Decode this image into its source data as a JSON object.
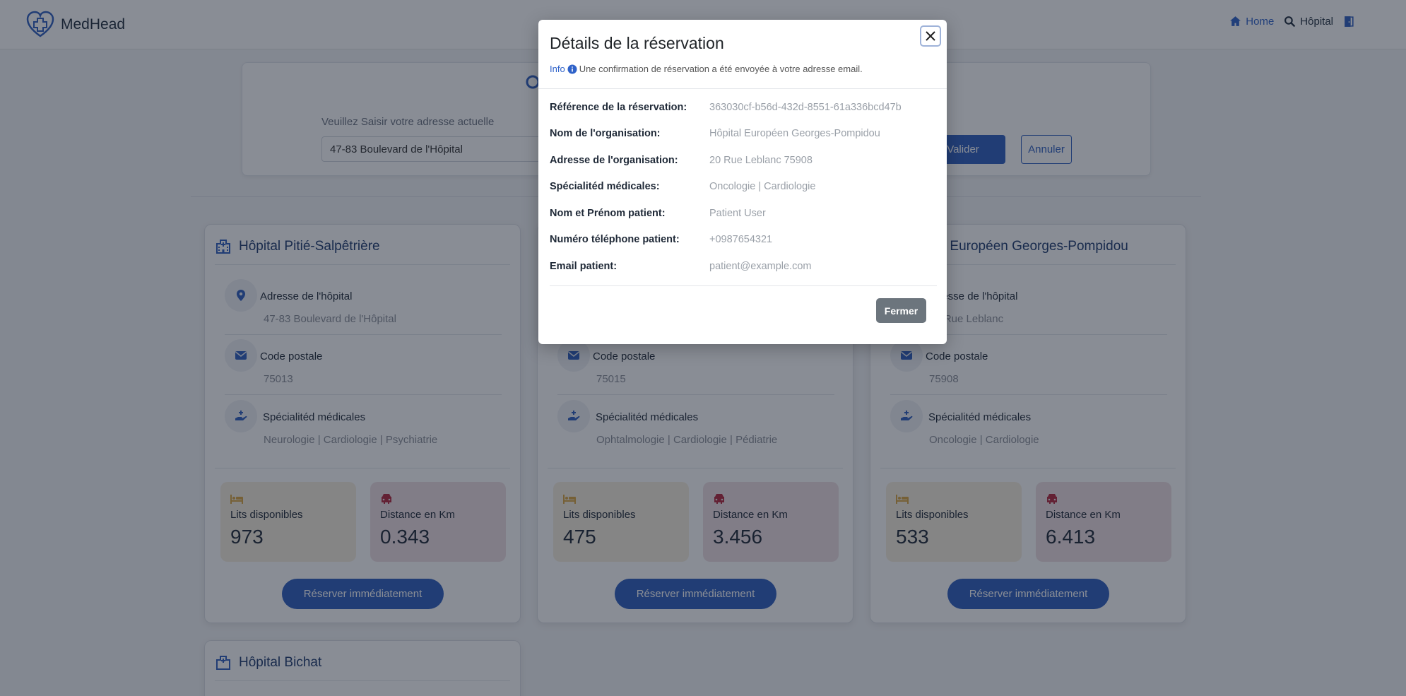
{
  "navbar": {
    "brand": "MedHead",
    "links": [
      {
        "label": "Home",
        "icon": "home-icon"
      },
      {
        "label": "Hôpital",
        "icon": "search-icon"
      },
      {
        "label": "",
        "icon": "logout-icon"
      }
    ]
  },
  "search": {
    "label": "Veuillez Saisir votre adresse actuelle",
    "value": "47-83 Boulevard de l'Hôpital",
    "submit_label": "Valider",
    "cancel_label": "Annuler"
  },
  "labels": {
    "address": "Adresse de l'hôpital",
    "postal": "Code postale",
    "specialties": "Spécialitéd médicales",
    "beds": "Lits disponibles",
    "distance": "Distance en Km",
    "reserve": "Réserver immédiatement"
  },
  "hospitals": [
    {
      "name": "Hôpital Pitié-Salpêtrière",
      "address": "47-83 Boulevard de l'Hôpital",
      "postal": "75013",
      "specialties": "Neurologie | Cardiologie | Psychiatrie",
      "beds": "973",
      "distance": "0.343"
    },
    {
      "name": "",
      "address": "",
      "postal": "75015",
      "specialties": "Ophtalmologie | Cardiologie | Pédiatrie",
      "beds": "475",
      "distance": "3.456"
    },
    {
      "name": "Hôpital Européen Georges-Pompidou",
      "address": "20 Rue Leblanc",
      "postal": "75908",
      "specialties": "Oncologie | Cardiologie",
      "beds": "533",
      "distance": "6.413"
    },
    {
      "name": "Hôpital Bichat"
    }
  ],
  "modal": {
    "title": "Détails de la réservation",
    "info_tag": "Info",
    "info_text": "Une confirmation de réservation a été envoyée à votre adresse email.",
    "details": [
      {
        "key": "Référence de la réservation:",
        "value": "363030cf-b56d-432d-8551-61a336bcd47b"
      },
      {
        "key": "Nom de l'organisation:",
        "value": "Hôpital Européen Georges-Pompidou"
      },
      {
        "key": "Adresse de l'organisation:",
        "value": "20 Rue Leblanc 75908"
      },
      {
        "key": "Spécialitéd médicales:",
        "value": "Oncologie | Cardiologie"
      },
      {
        "key": "Nom et Prénom patient:",
        "value": "Patient User"
      },
      {
        "key": "Numéro téléphone patient:",
        "value": "+0987654321"
      },
      {
        "key": "Email patient:",
        "value": "patient@example.com"
      }
    ],
    "close_label": "Fermer"
  },
  "colors": {
    "primary": "#2f5fbf",
    "beds_bg": "#f7efdf",
    "distance_bg": "#efdfe3",
    "beds_icon": "#d9a441",
    "distance_icon": "#b3263d",
    "secondary_button": "#6c757d"
  }
}
